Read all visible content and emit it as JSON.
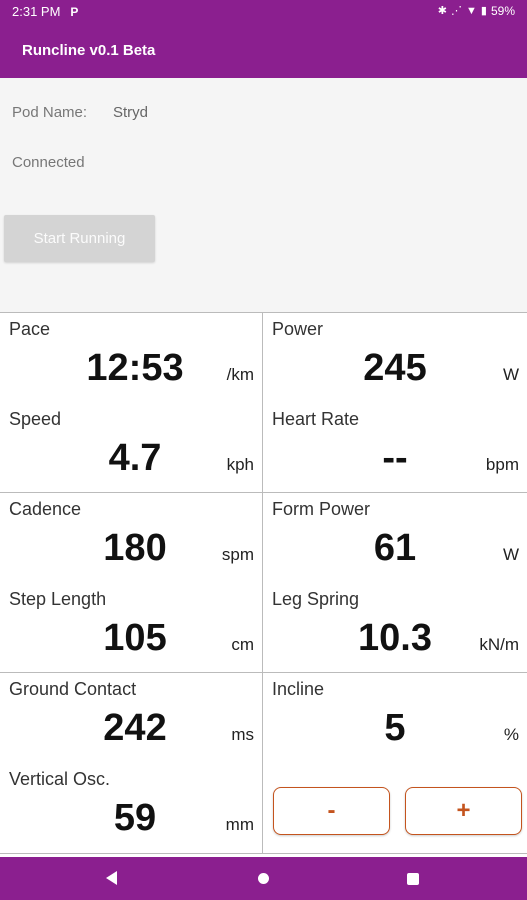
{
  "status_bar": {
    "time": "2:31 PM",
    "notification": "P",
    "battery": "59%",
    "icons": [
      "bluetooth-icon",
      "signal-icon",
      "wifi-icon",
      "battery-icon"
    ]
  },
  "app_bar": {
    "title": "Runcline v0.1 Beta"
  },
  "info": {
    "pod_label": "Pod Name:",
    "pod_value": "Stryd",
    "status": "Connected",
    "start_button": "Start Running"
  },
  "metrics": {
    "pace": {
      "label": "Pace",
      "value": "12:53",
      "unit": "/km"
    },
    "power": {
      "label": "Power",
      "value": "245",
      "unit": "W"
    },
    "speed": {
      "label": "Speed",
      "value": "4.7",
      "unit": "kph"
    },
    "heart_rate": {
      "label": "Heart Rate",
      "value": "--",
      "unit": "bpm"
    },
    "cadence": {
      "label": "Cadence",
      "value": "180",
      "unit": "spm"
    },
    "form_power": {
      "label": "Form Power",
      "value": "61",
      "unit": "W"
    },
    "step_length": {
      "label": "Step Length",
      "value": "105",
      "unit": "cm"
    },
    "leg_spring": {
      "label": "Leg Spring",
      "value": "10.3",
      "unit": "kN/m"
    },
    "ground_contact": {
      "label": "Ground Contact",
      "value": "242",
      "unit": "ms"
    },
    "incline": {
      "label": "Incline",
      "value": "5",
      "unit": "%"
    },
    "vertical_osc": {
      "label": "Vertical Osc.",
      "value": "59",
      "unit": "mm"
    }
  },
  "incline_controls": {
    "minus": "-",
    "plus": "+"
  },
  "colors": {
    "primary": "#8b1f8f",
    "accent": "#c4541e",
    "button_disabled": "#d4d4d4"
  }
}
